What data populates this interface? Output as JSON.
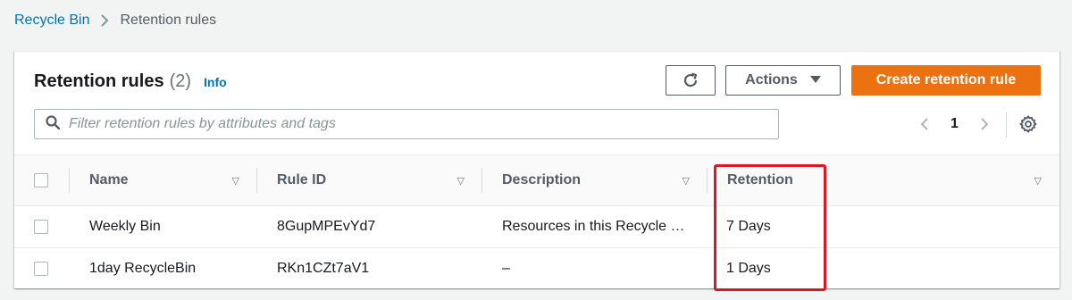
{
  "breadcrumb": {
    "parent": "Recycle Bin",
    "current": "Retention rules"
  },
  "header": {
    "title": "Retention rules",
    "count": "(2)",
    "info": "Info"
  },
  "toolbar": {
    "refresh_icon": "refresh-icon",
    "actions_label": "Actions",
    "create_label": "Create retention rule"
  },
  "search": {
    "placeholder": "Filter retention rules by attributes and tags",
    "value": ""
  },
  "pagination": {
    "current_page": "1"
  },
  "table": {
    "columns": [
      "Name",
      "Rule ID",
      "Description",
      "Retention"
    ],
    "rows": [
      {
        "name": "Weekly Bin",
        "rule_id": "8GupMPEvYd7",
        "description": "Resources in this Recycle …",
        "retention": "7 Days"
      },
      {
        "name": "1day RecycleBin",
        "rule_id": "RKn1CZt7aV1",
        "description": "–",
        "retention": "1 Days"
      }
    ]
  },
  "colors": {
    "accent": "#0073bb",
    "primary_button": "#ec7211",
    "highlight": "#e0151f"
  }
}
